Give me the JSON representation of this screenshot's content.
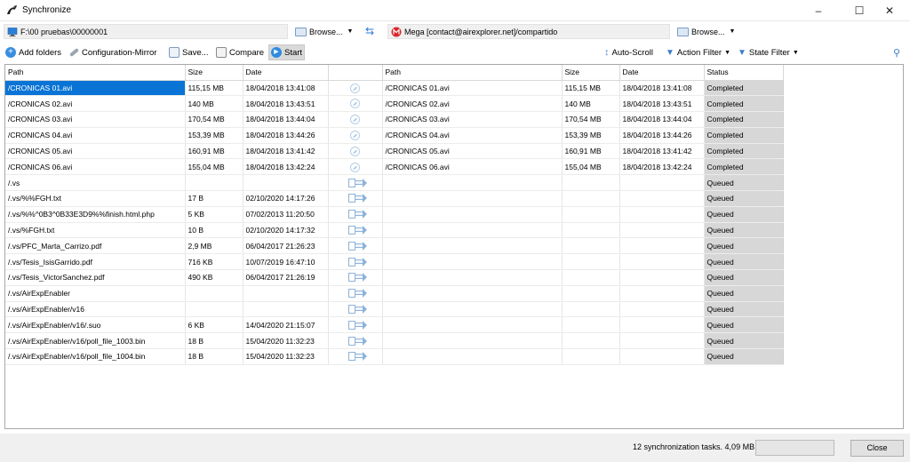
{
  "window": {
    "title": "Synchronize"
  },
  "left_path": {
    "value": "F:\\00 pruebas\\00000001",
    "icon": "computer-icon",
    "browse_label": "Browse..."
  },
  "right_path": {
    "value": "Mega [contact@airexplorer.net]/compartido",
    "icon": "mega-icon",
    "browse_label": "Browse..."
  },
  "toolbar": {
    "add_folders": "Add folders",
    "configuration": "Configuration-Mirror",
    "save": "Save...",
    "compare": "Compare",
    "start": "Start",
    "auto_scroll": "Auto-Scroll",
    "action_filter": "Action Filter",
    "state_filter": "State Filter"
  },
  "columns": {
    "left_path": "Path",
    "left_size": "Size",
    "left_date": "Date",
    "right_path": "Path",
    "right_size": "Size",
    "right_date": "Date",
    "status": "Status"
  },
  "rows": [
    {
      "lpath": "/CRONICAS 01.avi",
      "lsize": "115,15 MB",
      "ldate": "18/04/2018 13:41:08",
      "action": "equal",
      "rpath": "/CRONICAS 01.avi",
      "rsize": "115,15 MB",
      "rdate": "18/04/2018 13:41:08",
      "status": "Completed",
      "selected": true
    },
    {
      "lpath": "/CRONICAS 02.avi",
      "lsize": "140 MB",
      "ldate": "18/04/2018 13:43:51",
      "action": "equal",
      "rpath": "/CRONICAS 02.avi",
      "rsize": "140 MB",
      "rdate": "18/04/2018 13:43:51",
      "status": "Completed"
    },
    {
      "lpath": "/CRONICAS 03.avi",
      "lsize": "170,54 MB",
      "ldate": "18/04/2018 13:44:04",
      "action": "equal",
      "rpath": "/CRONICAS 03.avi",
      "rsize": "170,54 MB",
      "rdate": "18/04/2018 13:44:04",
      "status": "Completed"
    },
    {
      "lpath": "/CRONICAS 04.avi",
      "lsize": "153,39 MB",
      "ldate": "18/04/2018 13:44:26",
      "action": "equal",
      "rpath": "/CRONICAS 04.avi",
      "rsize": "153,39 MB",
      "rdate": "18/04/2018 13:44:26",
      "status": "Completed"
    },
    {
      "lpath": "/CRONICAS 05.avi",
      "lsize": "160,91 MB",
      "ldate": "18/04/2018 13:41:42",
      "action": "equal",
      "rpath": "/CRONICAS 05.avi",
      "rsize": "160,91 MB",
      "rdate": "18/04/2018 13:41:42",
      "status": "Completed"
    },
    {
      "lpath": "/CRONICAS 06.avi",
      "lsize": "155,04 MB",
      "ldate": "18/04/2018 13:42:24",
      "action": "equal",
      "rpath": "/CRONICAS 06.avi",
      "rsize": "155,04 MB",
      "rdate": "18/04/2018 13:42:24",
      "status": "Completed"
    },
    {
      "lpath": "/.vs",
      "lsize": "",
      "ldate": "",
      "action": "copy",
      "rpath": "",
      "rsize": "",
      "rdate": "",
      "status": "Queued"
    },
    {
      "lpath": "/.vs/%%FGH.txt",
      "lsize": "17 B",
      "ldate": "02/10/2020 14:17:26",
      "action": "copy",
      "rpath": "",
      "rsize": "",
      "rdate": "",
      "status": "Queued"
    },
    {
      "lpath": "/.vs/%%^0B3^0B33E3D9%%finish.html.php",
      "lsize": "5 KB",
      "ldate": "07/02/2013 11:20:50",
      "action": "copy",
      "rpath": "",
      "rsize": "",
      "rdate": "",
      "status": "Queued"
    },
    {
      "lpath": "/.vs/%FGH.txt",
      "lsize": "10 B",
      "ldate": "02/10/2020 14:17:32",
      "action": "copy",
      "rpath": "",
      "rsize": "",
      "rdate": "",
      "status": "Queued"
    },
    {
      "lpath": "/.vs/PFC_Marta_Carrizo.pdf",
      "lsize": "2,9 MB",
      "ldate": "06/04/2017 21:26:23",
      "action": "copy",
      "rpath": "",
      "rsize": "",
      "rdate": "",
      "status": "Queued"
    },
    {
      "lpath": "/.vs/Tesis_IsisGarrido.pdf",
      "lsize": "716 KB",
      "ldate": "10/07/2019 16:47:10",
      "action": "copy",
      "rpath": "",
      "rsize": "",
      "rdate": "",
      "status": "Queued"
    },
    {
      "lpath": "/.vs/Tesis_VictorSanchez.pdf",
      "lsize": "490 KB",
      "ldate": "06/04/2017 21:26:19",
      "action": "copy",
      "rpath": "",
      "rsize": "",
      "rdate": "",
      "status": "Queued"
    },
    {
      "lpath": "/.vs/AirExpEnabler",
      "lsize": "",
      "ldate": "",
      "action": "copy",
      "rpath": "",
      "rsize": "",
      "rdate": "",
      "status": "Queued"
    },
    {
      "lpath": "/.vs/AirExpEnabler/v16",
      "lsize": "",
      "ldate": "",
      "action": "copy",
      "rpath": "",
      "rsize": "",
      "rdate": "",
      "status": "Queued"
    },
    {
      "lpath": "/.vs/AirExpEnabler/v16/.suo",
      "lsize": "6 KB",
      "ldate": "14/04/2020 21:15:07",
      "action": "copy",
      "rpath": "",
      "rsize": "",
      "rdate": "",
      "status": "Queued"
    },
    {
      "lpath": "/.vs/AirExpEnabler/v16/poll_file_1003.bin",
      "lsize": "18 B",
      "ldate": "15/04/2020 11:32:23",
      "action": "copy",
      "rpath": "",
      "rsize": "",
      "rdate": "",
      "status": "Queued"
    },
    {
      "lpath": "/.vs/AirExpEnabler/v16/poll_file_1004.bin",
      "lsize": "18 B",
      "ldate": "15/04/2020 11:32:23",
      "action": "copy",
      "rpath": "",
      "rsize": "",
      "rdate": "",
      "status": "Queued"
    }
  ],
  "footer": {
    "summary": "12 synchronization tasks. 4,09 MB",
    "progress": 0,
    "close_label": "Close"
  },
  "colors": {
    "selection": "#0a74d6",
    "status_bg": "#d7d7d7",
    "accent": "#2a7ad6",
    "mega_red": "#d9272e"
  }
}
